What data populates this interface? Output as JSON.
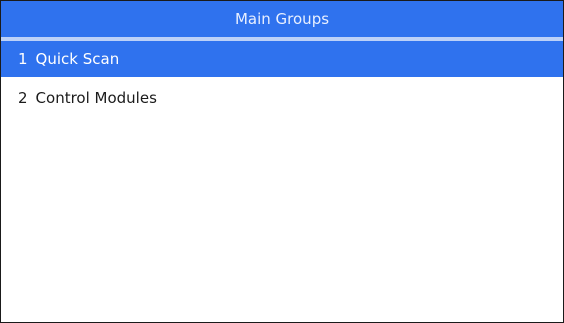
{
  "header": {
    "title": "Main Groups"
  },
  "menu": {
    "items": [
      {
        "index": "1",
        "label": "Quick Scan",
        "selected": true
      },
      {
        "index": "2",
        "label": "Control Modules",
        "selected": false
      }
    ]
  },
  "colors": {
    "accent": "#2f72ee",
    "divider": "#bcd1f8",
    "background": "#ffffff"
  }
}
